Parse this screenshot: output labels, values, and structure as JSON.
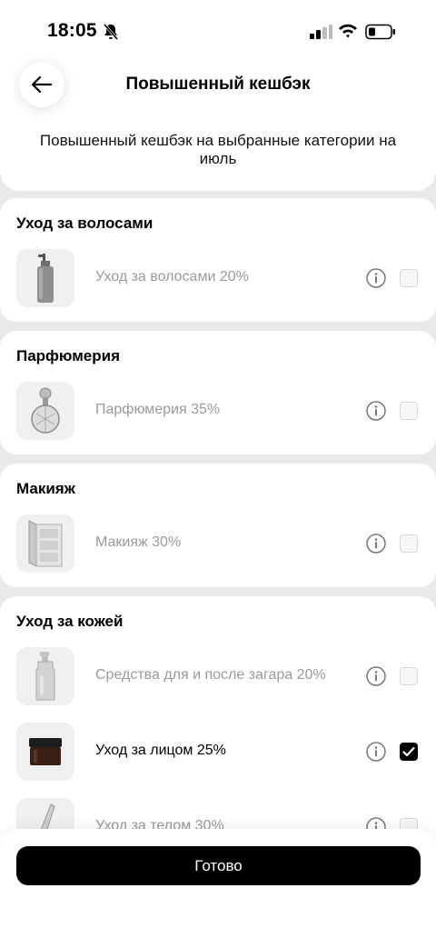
{
  "status_bar": {
    "time": "18:05"
  },
  "header": {
    "title": "Повышенный кешбэк",
    "subtitle": "Повышенный кешбэк на выбранные категории на июль"
  },
  "categories": [
    {
      "title": "Уход за волосами",
      "items": [
        {
          "label": "Уход за волосами 20%",
          "icon": "hair-care-bottle-icon",
          "checked": false
        }
      ]
    },
    {
      "title": "Парфюмерия",
      "items": [
        {
          "label": "Парфюмерия 35%",
          "icon": "perfume-bottle-icon",
          "checked": false
        }
      ]
    },
    {
      "title": "Макияж",
      "items": [
        {
          "label": "Макияж 30%",
          "icon": "makeup-palette-icon",
          "checked": false
        }
      ]
    },
    {
      "title": "Уход за кожей",
      "items": [
        {
          "label": "Средства для и после загара 20%",
          "icon": "sunscreen-bottle-icon",
          "checked": false
        },
        {
          "label": "Уход за лицом 25%",
          "icon": "face-cream-jar-icon",
          "checked": true
        },
        {
          "label": "Уход за телом 30%",
          "icon": "body-care-tube-icon",
          "checked": false
        }
      ]
    }
  ],
  "footer": {
    "done_label": "Готово"
  },
  "colors": {
    "accent": "#000000",
    "inactive_text": "#9a9a9a",
    "background": "#e9e9e9"
  }
}
